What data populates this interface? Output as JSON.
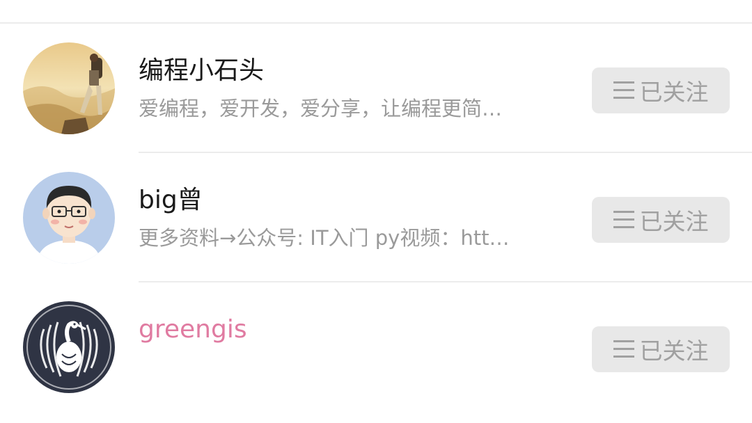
{
  "users": [
    {
      "name": "编程小石头",
      "name_color": "#1a1a1a",
      "bio": "爱编程，爱开发，爱分享，让编程更简…",
      "follow_label": "已关注",
      "avatar_icon": "hiker-mountain-avatar"
    },
    {
      "name": "big曾",
      "name_color": "#1a1a1a",
      "bio": "更多资料→公众号: IT入门 py视频：htt…",
      "follow_label": "已关注",
      "avatar_icon": "cartoon-man-glasses-avatar"
    },
    {
      "name": "greengis",
      "name_color": "#e07ba1",
      "bio": "",
      "follow_label": "已关注",
      "avatar_icon": "crane-crest-avatar"
    }
  ],
  "colors": {
    "button_bg": "#e8e8e8",
    "button_text": "#a0a0a0",
    "bio_text": "#9a9a9a"
  }
}
